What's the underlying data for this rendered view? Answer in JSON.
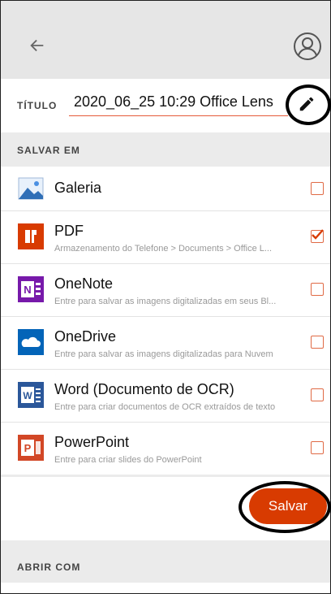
{
  "header": {
    "back_icon": "arrow-left-icon",
    "profile_icon": "user-circle-icon"
  },
  "title_field": {
    "label": "TÍTULO",
    "value": "2020_06_25 10:29 Office Lens",
    "edit_icon": "pencil-icon"
  },
  "save_to": {
    "label": "SALVAR EM",
    "items": [
      {
        "name": "Galeria",
        "desc": "",
        "icon": "gallery-icon",
        "checked": false
      },
      {
        "name": "PDF",
        "desc": "Armazenamento do Telefone > Documents > Office L...",
        "icon": "pdf-icon",
        "checked": true
      },
      {
        "name": "OneNote",
        "desc": "Entre para salvar as imagens digitalizadas em seus Bl...",
        "icon": "onenote-icon",
        "checked": false
      },
      {
        "name": "OneDrive",
        "desc": "Entre para salvar as imagens digitalizadas para Nuvem",
        "icon": "onedrive-icon",
        "checked": false
      },
      {
        "name": "Word (Documento de OCR)",
        "desc": "Entre para criar documentos de OCR extraídos de texto",
        "icon": "word-icon",
        "checked": false
      },
      {
        "name": "PowerPoint",
        "desc": "Entre para criar slides do PowerPoint",
        "icon": "powerpoint-icon",
        "checked": false
      }
    ]
  },
  "save_button": {
    "label": "Salvar"
  },
  "open_with": {
    "label": "ABRIR COM"
  },
  "colors": {
    "accent": "#d83b01",
    "pdf": "#d83b01",
    "onenote": "#7719aa",
    "onedrive": "#0364b8",
    "word": "#2b579a",
    "powerpoint": "#d24726"
  }
}
